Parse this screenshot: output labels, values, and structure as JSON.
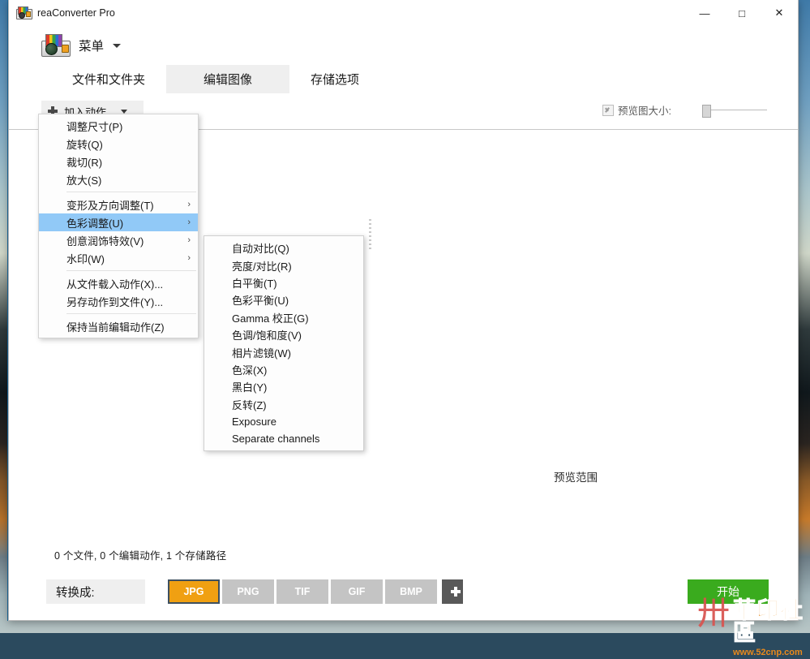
{
  "window": {
    "title": "reaConverter Pro",
    "title_icon": "app-camera-icon",
    "controls": {
      "minimize": "—",
      "maximize": "□",
      "close": "✕"
    }
  },
  "menubar": {
    "icon": "app-camera-palette-icon",
    "label": "菜单",
    "caret": "▾"
  },
  "tabs": [
    {
      "label": "文件和文件夹",
      "active": false
    },
    {
      "label": "编辑图像",
      "active": true
    },
    {
      "label": "存储选项",
      "active": false
    }
  ],
  "toolbar": {
    "add_action_label": "加入动作",
    "add_action_icon": "plus-icon",
    "caret": "▾",
    "preview_size_label": "预览图大小:",
    "preview_size_checked": true,
    "slider_value": 0
  },
  "dropdown": {
    "items": [
      {
        "label": "调整尺寸(P)",
        "submenu": false,
        "selected": false
      },
      {
        "label": "旋转(Q)",
        "submenu": false,
        "selected": false
      },
      {
        "label": "裁切(R)",
        "submenu": false,
        "selected": false
      },
      {
        "label": "放大(S)",
        "submenu": false,
        "selected": false
      },
      {
        "separator": true
      },
      {
        "label": "变形及方向调整(T)",
        "submenu": true,
        "selected": false
      },
      {
        "label": "色彩调整(U)",
        "submenu": true,
        "selected": true
      },
      {
        "label": "创意润饰特效(V)",
        "submenu": true,
        "selected": false
      },
      {
        "label": "水印(W)",
        "submenu": true,
        "selected": false
      },
      {
        "separator": true
      },
      {
        "label": "从文件载入动作(X)...",
        "submenu": false,
        "selected": false
      },
      {
        "label": "另存动作到文件(Y)...",
        "submenu": false,
        "selected": false
      },
      {
        "separator": true
      },
      {
        "label": "保持当前编辑动作(Z)",
        "submenu": false,
        "selected": false
      }
    ],
    "submenu_arrow": "›"
  },
  "submenu": {
    "items": [
      {
        "label": "自动对比(Q)"
      },
      {
        "label": "亮度/对比(R)"
      },
      {
        "label": "白平衡(T)"
      },
      {
        "label": "色彩平衡(U)"
      },
      {
        "label": "Gamma 校正(G)"
      },
      {
        "label": "色调/饱和度(V)"
      },
      {
        "label": "相片滤镜(W)"
      },
      {
        "label": "色深(X)"
      },
      {
        "label": "黑白(Y)"
      },
      {
        "label": "反转(Z)"
      },
      {
        "label": "Exposure"
      },
      {
        "label": "Separate channels"
      }
    ]
  },
  "preview": {
    "text": "预览范围"
  },
  "status": {
    "text": "0 个文件,  0 个编辑动作,  1 个存储路径"
  },
  "bottom": {
    "convert_label": "转换成:",
    "formats": [
      {
        "label": "JPG",
        "selected": true
      },
      {
        "label": "PNG",
        "selected": false
      },
      {
        "label": "TIF",
        "selected": false
      },
      {
        "label": "GIF",
        "selected": false
      },
      {
        "label": "BMP",
        "selected": false
      }
    ],
    "add_format_icon": "plus-icon",
    "start_label": "开始"
  },
  "watermark": {
    "mark": "卅",
    "title": "華印社區",
    "url": "www.52cnp.com"
  },
  "colors": {
    "accent_orange": "#f0a012",
    "start_green": "#3aab1e",
    "menu_highlight": "#91c9f7",
    "tab_active_bg": "#efefef",
    "format_inactive": "#c4c4c4"
  }
}
